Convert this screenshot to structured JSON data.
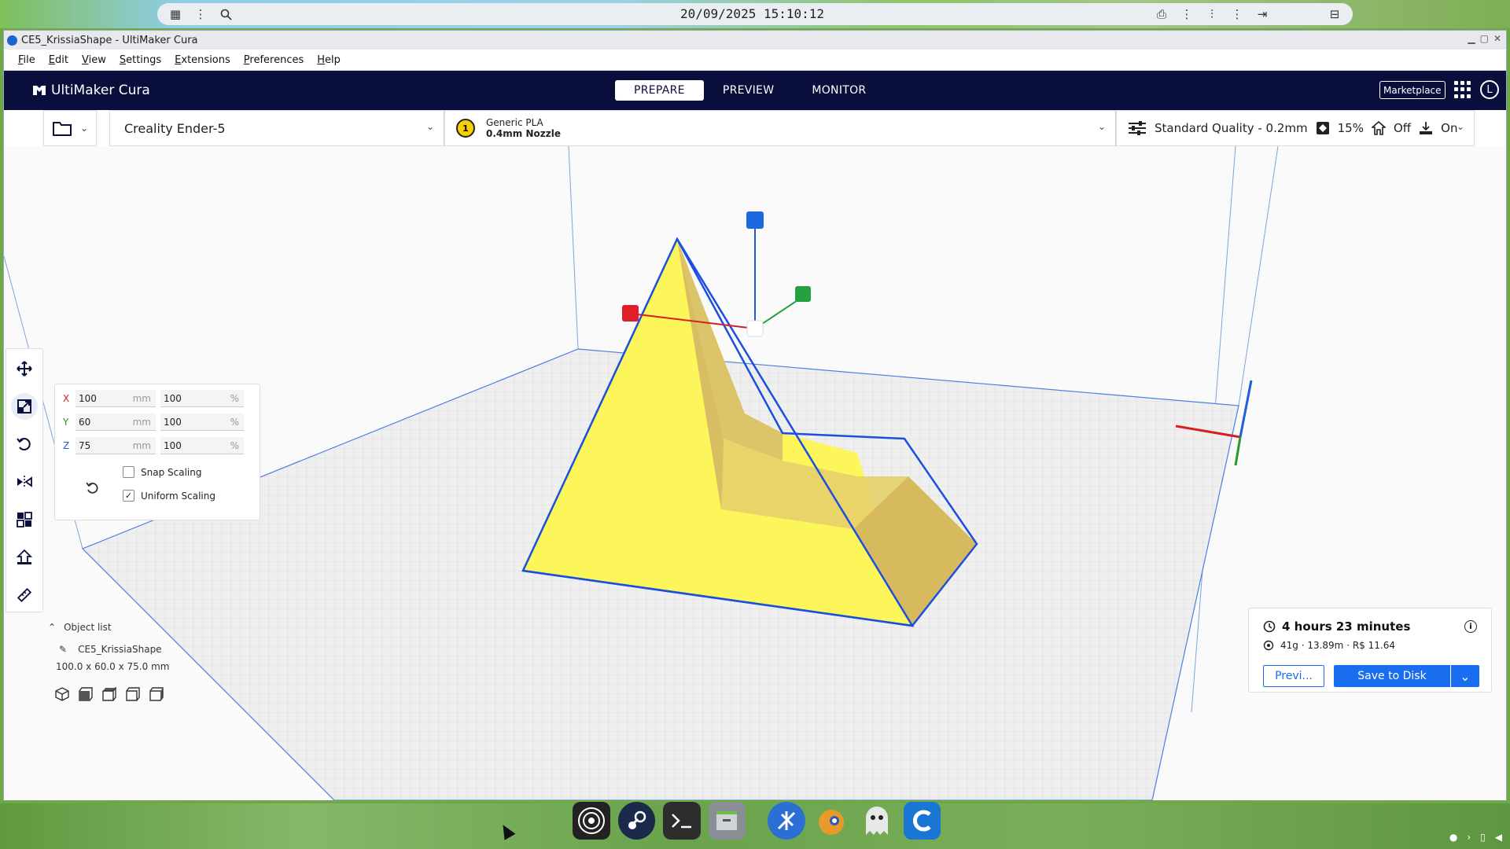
{
  "system_bar": {
    "datetime": "20/09/2025 15:10:12"
  },
  "window": {
    "title": "CE5_KrissiaShape - UltiMaker Cura"
  },
  "menu": [
    "File",
    "Edit",
    "View",
    "Settings",
    "Extensions",
    "Preferences",
    "Help"
  ],
  "header": {
    "logo_text": "UltiMaker Cura",
    "tabs": [
      "PREPARE",
      "PREVIEW",
      "MONITOR"
    ],
    "active_tab": "PREPARE",
    "marketplace_label": "Marketplace",
    "account_initial": "L"
  },
  "printer": {
    "name": "Creality Ender-5"
  },
  "material": {
    "extruder_number": "1",
    "name": "Generic PLA",
    "nozzle": "0.4mm Nozzle"
  },
  "print_settings": {
    "profile": "Standard Quality - 0.2mm",
    "infill": "15%",
    "support": "Off",
    "adhesion": "On"
  },
  "scale_tool": {
    "rows": [
      {
        "axis": "X",
        "mm": "100",
        "percent": "100",
        "color": "#d62020"
      },
      {
        "axis": "Y",
        "mm": "60",
        "percent": "100",
        "color": "#2a9a2a"
      },
      {
        "axis": "Z",
        "mm": "75",
        "percent": "100",
        "color": "#1c5fd6"
      }
    ],
    "mm_unit": "mm",
    "percent_unit": "%",
    "snap_scaling_label": "Snap Scaling",
    "snap_scaling_checked": false,
    "uniform_scaling_label": "Uniform Scaling",
    "uniform_scaling_checked": true
  },
  "object_list": {
    "header": "Object list",
    "object_name": "CE5_KrissiaShape",
    "dimensions": "100.0 x 60.0 x 75.0 mm"
  },
  "print_estimate": {
    "time": "4 hours 23 minutes",
    "material": "41g · 13.89m · R$ 11.64",
    "preview_label": "Previ...",
    "save_label": "Save to Disk"
  },
  "colors": {
    "header_bg": "#0a0e3d",
    "accent": "#196ef0",
    "model_fill": "#fdf65a",
    "model_shade": "#d8b860",
    "model_outline": "#1a4fe0"
  },
  "icons": {
    "tools": [
      "move-icon",
      "scale-icon",
      "rotate-icon",
      "mirror-icon",
      "per-model-settings-icon",
      "support-blocker-icon",
      "measure-icon"
    ],
    "dock": [
      "obs-icon",
      "steam-icon",
      "terminal-icon",
      "files-icon",
      "krita-icon",
      "blender-icon",
      "ghost-icon",
      "cura-icon"
    ]
  }
}
